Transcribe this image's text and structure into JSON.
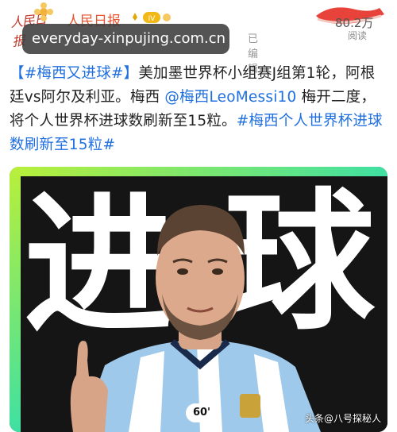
{
  "header": {
    "logo_text": "人民日报",
    "account_name": "人民日报",
    "meta": [
      "已编辑"
    ],
    "read_count": "80.2万",
    "read_label": "阅读"
  },
  "watermark": "everyday-xinpujing.com.cn",
  "post": {
    "hashtag1": "【#梅西又进球#】",
    "text1": "美加墨世界杯小组赛J组第1轮，阿根廷vs阿尔及利亚。梅西",
    "mention": "@梅西LeoMessi10",
    "text2": "梅开二度，将个人世界杯进球数刷新至15粒。",
    "hashtag2": "#梅西个人世界杯进球数刷新至15粒#"
  },
  "image": {
    "big_text_1": "进",
    "big_text_2": "球",
    "badge": "60'",
    "source": "头条@八号探秘人"
  },
  "colors": {
    "accent_orange": "#e8542d",
    "link_blue": "#1f6fe0",
    "lime": "#b9ef3a"
  }
}
